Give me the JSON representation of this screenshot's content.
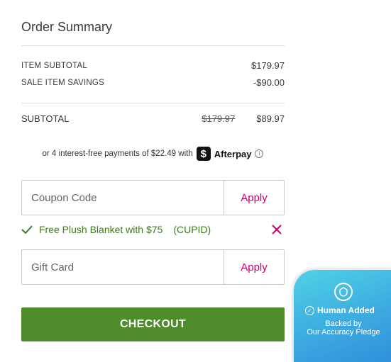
{
  "summary": {
    "title": "Order Summary",
    "item_subtotal_label": "ITEM SUBTOTAL",
    "item_subtotal_value": "$179.97",
    "sale_savings_label": "SALE ITEM SAVINGS",
    "sale_savings_value": "-$90.00",
    "subtotal_label": "SUBTOTAL",
    "subtotal_original": "$179.97",
    "subtotal_value": "$89.97"
  },
  "afterpay": {
    "text": "or 4 interest-free payments of $22.49 with",
    "logo_glyph": "$",
    "brand": "Afterpay",
    "info_icon": "info-icon"
  },
  "coupon": {
    "placeholder": "Coupon Code",
    "value": "",
    "apply_label": "Apply"
  },
  "applied_promo": {
    "text": "Free Plush Blanket with $75",
    "code": "(CUPID)",
    "check_icon": "check-icon",
    "remove_icon": "close-icon"
  },
  "gift_card": {
    "placeholder": "Gift Card",
    "value": "",
    "apply_label": "Apply"
  },
  "checkout": {
    "label": "CHECKOUT"
  },
  "badge": {
    "icon": "shield-icon",
    "line1": "Human Added",
    "line2": "Backed by",
    "line3": "Our Accuracy Pledge"
  },
  "colors": {
    "accent": "#c8006e",
    "checkout_green": "#4f8a2b",
    "promo_green": "#3f7a1f",
    "badge_blue": "#3ba7e0"
  }
}
